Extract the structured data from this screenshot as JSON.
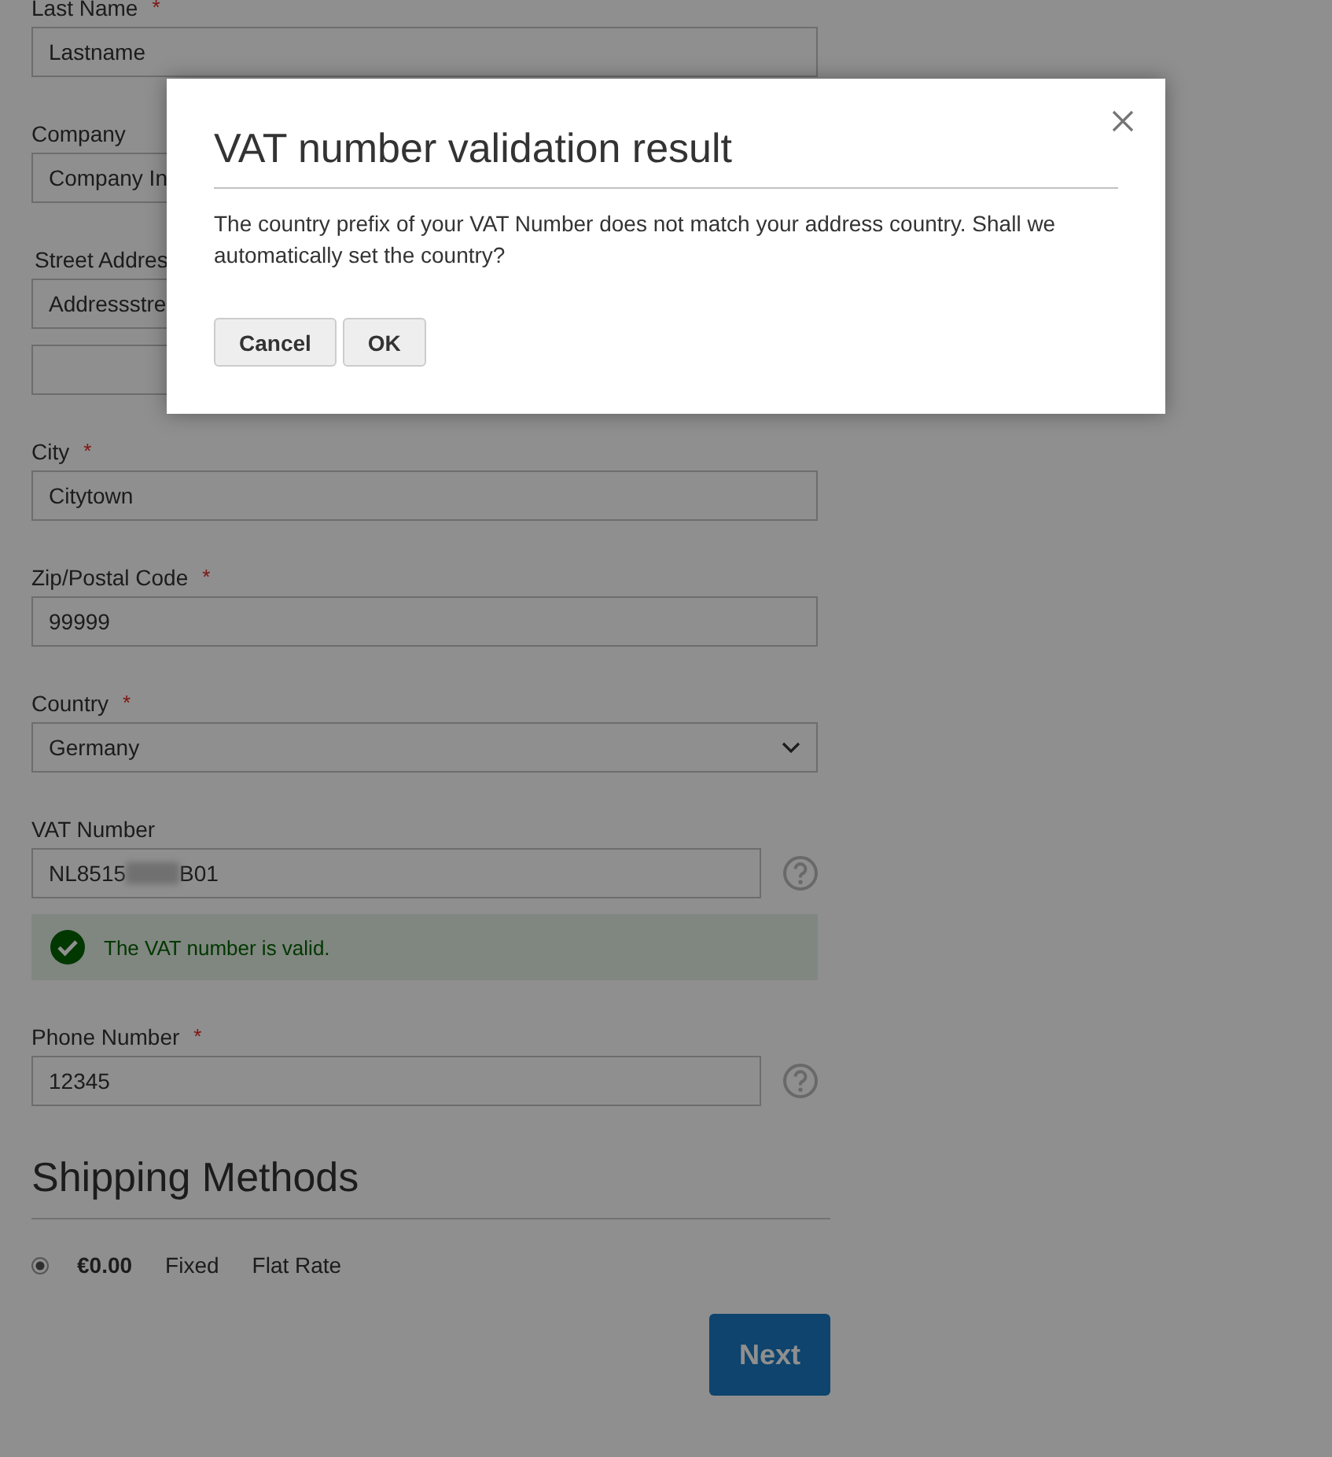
{
  "form": {
    "fields": [
      {
        "kind": "text",
        "label": "Last Name",
        "required_marker": "*",
        "value": "Lastname"
      },
      {
        "kind": "text",
        "label": "Company",
        "value": "Company In"
      },
      {
        "kind": "street",
        "label": "Street Addres",
        "value": "Addressstre",
        "extra_line": true
      },
      {
        "kind": "text",
        "label": "City",
        "required_marker": "*",
        "value": "Citytown"
      },
      {
        "kind": "text",
        "label": "Zip/Postal Code",
        "required_marker": "*",
        "value": "99999"
      },
      {
        "kind": "select",
        "label": "Country",
        "required_marker": "*",
        "value": "Germany"
      },
      {
        "kind": "vat",
        "label": "VAT Number",
        "value_start": "NL8515",
        "value_end": "B01",
        "help": true,
        "message": {
          "text": "The VAT number is valid.",
          "valid": true
        }
      },
      {
        "kind": "text",
        "label": "Phone Number",
        "required_marker": "*",
        "value": "12345",
        "help": true
      }
    ]
  },
  "shipping": {
    "title": "Shipping Methods",
    "methods": [
      {
        "price": "€0.00",
        "method": "Fixed",
        "carrier": "Flat Rate",
        "selected": true
      }
    ],
    "next_button": "Next"
  },
  "modal": {
    "title": "VAT number validation result",
    "message": "The country prefix of your VAT Number does not match your address country. Shall we automatically set the country?",
    "buttons": [
      "Cancel",
      "OK"
    ]
  }
}
